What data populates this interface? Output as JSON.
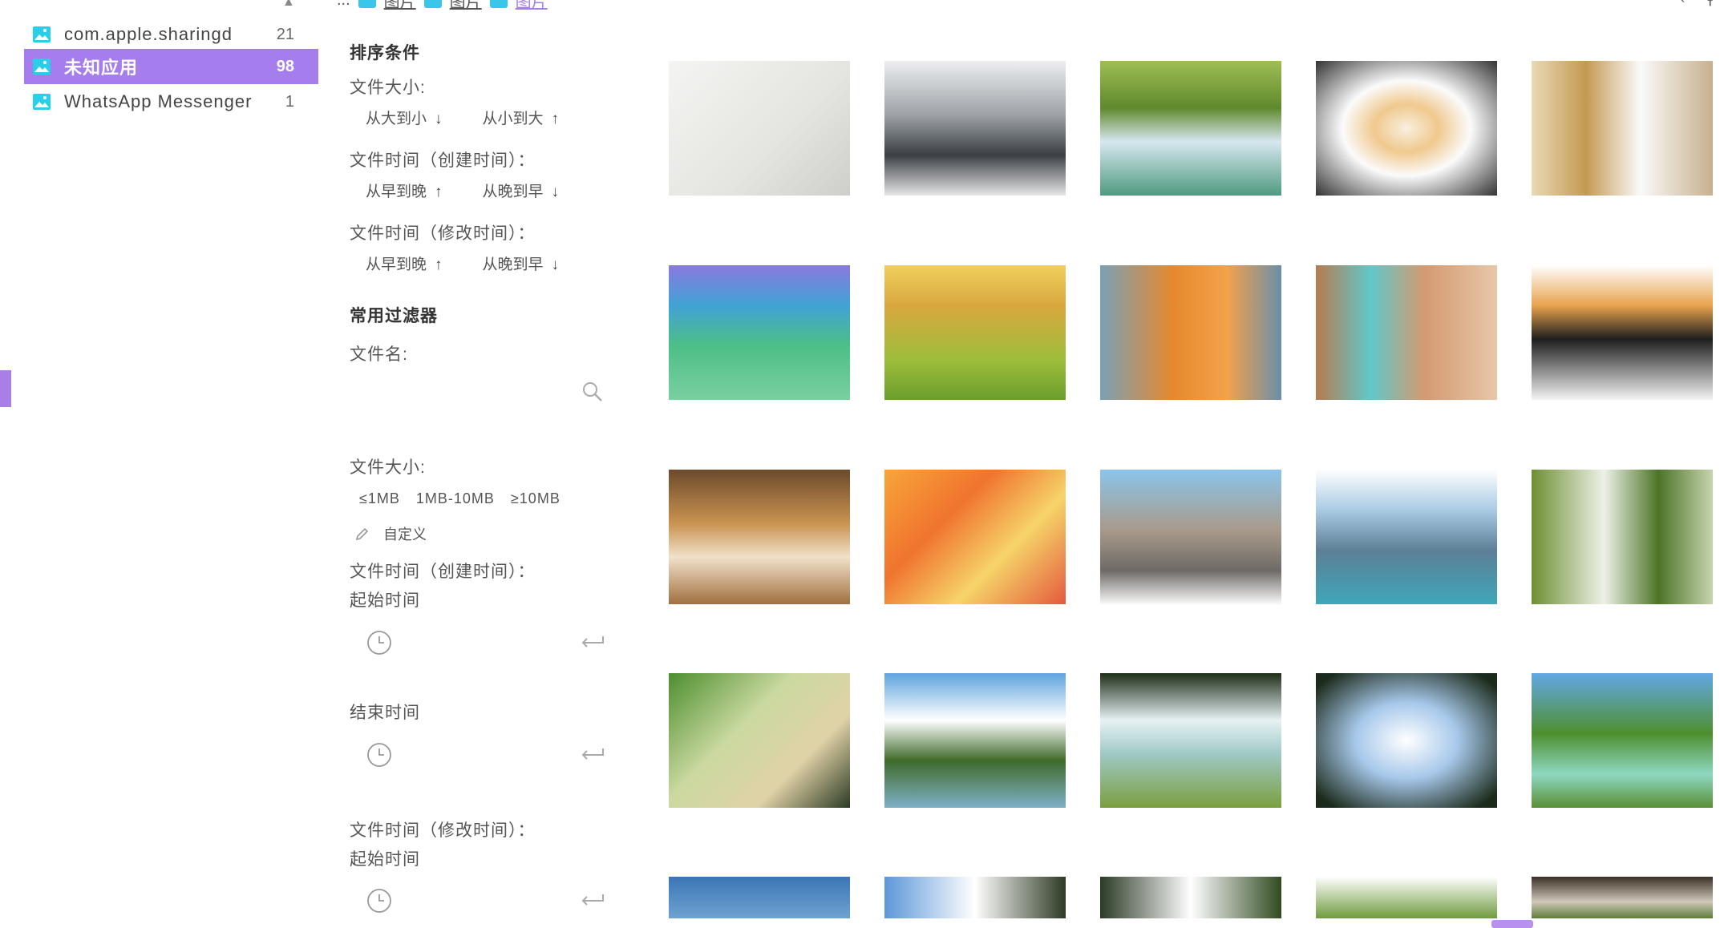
{
  "sidebar": {
    "items": [
      {
        "label": "com.apple.sharingd",
        "count": "21",
        "selected": false
      },
      {
        "label": "未知应用",
        "count": "98",
        "selected": true
      },
      {
        "label": "WhatsApp Messenger",
        "count": "1",
        "selected": false
      }
    ]
  },
  "breadcrumb": {
    "items": [
      "...",
      "图片",
      "图片",
      "图片"
    ]
  },
  "sort": {
    "title": "排序条件",
    "size_label": "文件大小:",
    "size_desc": "从大到小",
    "size_asc": "从小到大",
    "created_label": "文件时间（创建时间）：",
    "created_early": "从早到晚",
    "created_late": "从晚到早",
    "modified_label": "文件时间（修改时间）：",
    "modified_early": "从早到晚",
    "modified_late": "从晚到早"
  },
  "filters": {
    "title": "常用过滤器",
    "filename_label": "文件名:",
    "filename_value": "",
    "size_label": "文件大小:",
    "size_options": [
      "≤1MB",
      "1MB-10MB",
      "≥10MB"
    ],
    "custom_label": "自定义",
    "created_label": "文件时间（创建时间）：",
    "start_label": "起始时间",
    "end_label": "结束时间",
    "modified_label": "文件时间（修改时间）：",
    "modified_start_label": "起始时间"
  },
  "colors": {
    "accent": "#a57dec",
    "folder": "#3ac6ea"
  }
}
